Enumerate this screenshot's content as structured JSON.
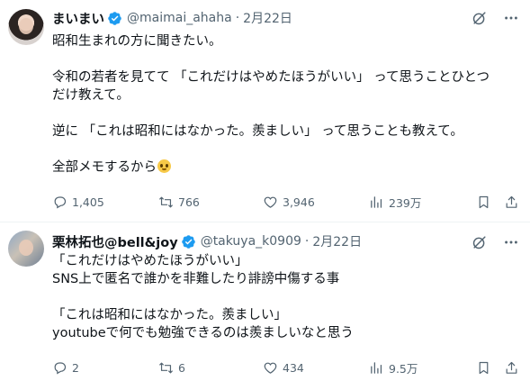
{
  "tweets": [
    {
      "author": {
        "name": "まいまい",
        "handle": "@maimai_ahaha",
        "date": "2月22日",
        "verified": true
      },
      "paragraphs": [
        "昭和生まれの方に聞きたい。",
        "",
        "令和の若者を見てて 「これだけはやめたほうがいい」 って思うことひとつ",
        "だけ教えて。",
        "",
        "逆に 「これは昭和にはなかった。羨ましい」 って思うことも教えて。",
        "",
        "全部メモするから"
      ],
      "emoji": "pleading-face-emoji",
      "stats": {
        "replies": "1,405",
        "retweets": "766",
        "likes": "3,946",
        "views": "239万"
      }
    },
    {
      "author": {
        "name": "栗林拓也@bell&joy",
        "handle": "@takuya_k0909",
        "date": "2月22日",
        "verified": true
      },
      "paragraphs": [
        "「これだけはやめたほうがいい」",
        "SNS上で匿名で誰かを非難したり誹謗中傷する事",
        "",
        "「これは昭和にはなかった。羨ましい」",
        "youtubeで何でも勉強できるのは羨ましいなと思う"
      ],
      "stats": {
        "replies": "2",
        "retweets": "6",
        "likes": "434",
        "views": "9.5万"
      }
    }
  ],
  "dot": "·",
  "colors": {
    "text": "#0f1419",
    "secondary": "#536471",
    "verified": "#1d9bf0",
    "border": "#eff3f4"
  }
}
